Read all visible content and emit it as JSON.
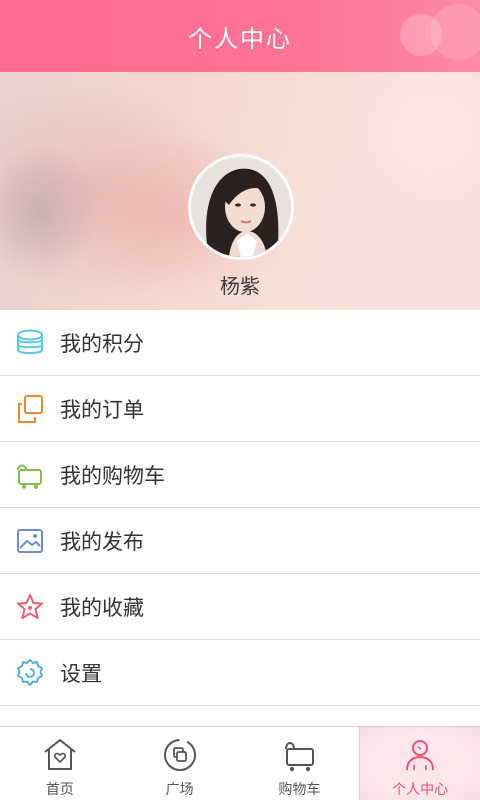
{
  "header": {
    "title": "个人中心"
  },
  "profile": {
    "name": "杨紫"
  },
  "menu": {
    "items": [
      {
        "label": "我的积分",
        "icon": "coins-stack-icon",
        "color": "#5bc8e8"
      },
      {
        "label": "我的订单",
        "icon": "orders-icon",
        "color": "#f08a2c"
      },
      {
        "label": "我的购物车",
        "icon": "shopping-cart-icon",
        "color": "#7cc24a"
      },
      {
        "label": "我的发布",
        "icon": "picture-icon",
        "color": "#6d8ee0"
      },
      {
        "label": "我的收藏",
        "icon": "star-icon",
        "color": "#ee5f6e"
      },
      {
        "label": "设置",
        "icon": "gear-icon",
        "color": "#4aa6e8"
      }
    ]
  },
  "tabbar": {
    "items": [
      {
        "label": "首页",
        "icon": "home-heart-icon"
      },
      {
        "label": "广场",
        "icon": "square-circle-icon"
      },
      {
        "label": "购物车",
        "icon": "cart-icon"
      },
      {
        "label": "个人中心",
        "icon": "person-icon",
        "active": true
      }
    ]
  },
  "colors": {
    "brand": "#fd7395",
    "active_tab_text": "#f0506e",
    "text": "#333333"
  }
}
